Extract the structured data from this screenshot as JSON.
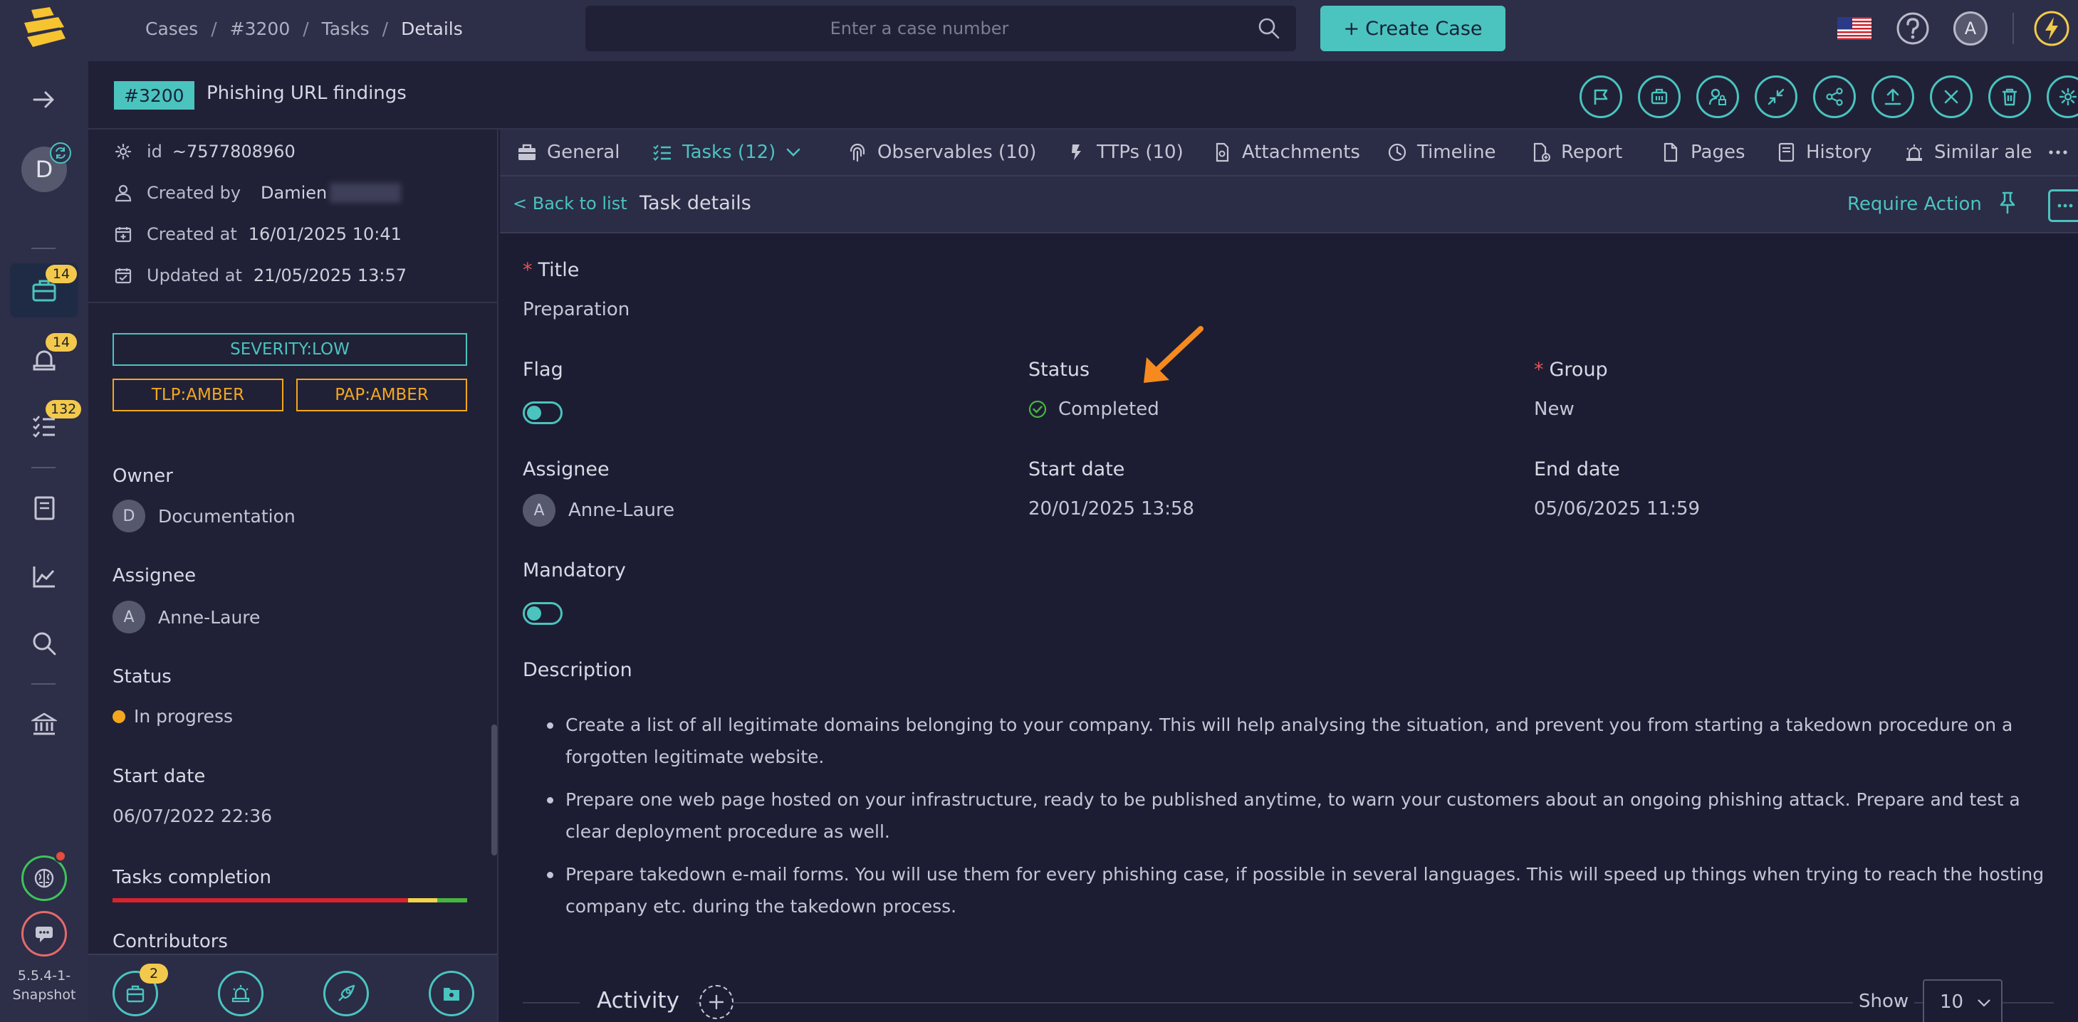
{
  "topbar": {
    "breadcrumb": [
      "Cases",
      "#3200",
      "Tasks",
      "Details"
    ],
    "breadcrumb_sep": "/",
    "search_placeholder": "Enter a case number",
    "create_case_label": "Create Case",
    "create_case_plus": "+",
    "user_initial": "A",
    "accent_color": "#4bc3be"
  },
  "nav": {
    "user_initial": "D",
    "cases_badge": "14",
    "alerts_badge": "14",
    "tasks_badge": "132",
    "version": "5.5.4-1-Snapshot"
  },
  "case": {
    "id_label": "#3200",
    "title": "Phishing URL findings",
    "actions": [
      "flag-icon",
      "merge-icon",
      "share-lock-icon",
      "collapse-icon",
      "share-icon",
      "export-icon",
      "close-icon",
      "delete-icon",
      "settings-icon"
    ]
  },
  "panel": {
    "id_label": "id",
    "id_value": "~7577808960",
    "created_by_label": "Created by",
    "created_by_value": "Damien",
    "created_at_label": "Created at",
    "created_at_value": "16/01/2025 10:41",
    "updated_at_label": "Updated at",
    "updated_at_value": "21/05/2025 13:57",
    "severity": "SEVERITY:LOW",
    "tlp": "TLP:AMBER",
    "pap": "PAP:AMBER",
    "owner_label": "Owner",
    "owner_initial": "D",
    "owner_value": "Documentation",
    "assignee_label": "Assignee",
    "assignee_initial": "A",
    "assignee_value": "Anne-Laure",
    "status_label": "Status",
    "status_value": "In progress",
    "start_date_label": "Start date",
    "start_date_value": "06/07/2022 22:36",
    "tasks_completion_label": "Tasks completion",
    "tasks_completion": {
      "red": 0.834,
      "yellow": 0.082,
      "green": 0.084
    },
    "contributors_label": "Contributors",
    "bottom_badge": "2"
  },
  "tabs": [
    {
      "label": "General",
      "icon": "briefcase-icon"
    },
    {
      "label": "Tasks (12)",
      "icon": "tasks-icon"
    },
    {
      "label": "Observables (10)",
      "icon": "fingerprint-icon"
    },
    {
      "label": "TTPs (10)",
      "icon": "ttp-icon"
    },
    {
      "label": "Attachments",
      "icon": "attachment-icon"
    },
    {
      "label": "Timeline",
      "icon": "clock-icon"
    },
    {
      "label": "Report",
      "icon": "report-icon"
    },
    {
      "label": "Pages",
      "icon": "page-icon"
    },
    {
      "label": "History",
      "icon": "history-icon"
    },
    {
      "label": "Similar ale",
      "icon": "alert-icon"
    }
  ],
  "subheader": {
    "back_label": "< Back to list",
    "title": "Task details",
    "require_action_label": "Require Action"
  },
  "task": {
    "title_label": "Title",
    "title_value": "Preparation",
    "flag_label": "Flag",
    "status_label": "Status",
    "status_value": "Completed",
    "group_label": "Group",
    "group_value": "New",
    "assignee_label": "Assignee",
    "assignee_initial": "A",
    "assignee_value": "Anne-Laure",
    "start_date_label": "Start date",
    "start_date_value": "20/01/2025 13:58",
    "end_date_label": "End date",
    "end_date_value": "05/06/2025 11:59",
    "mandatory_label": "Mandatory",
    "description_label": "Description",
    "required_mark": "*",
    "description_items": [
      "Create a list of all legitimate domains belonging to your company. This will help analysing the situation, and prevent you from starting a takedown procedure on a forgotten legitimate website.",
      "Prepare one web page hosted on your infrastructure, ready to be published anytime, to warn your customers about an ongoing phishing attack. Prepare and test a clear deployment procedure as well.",
      "Prepare takedown e-mail forms. You will use them for every phishing case, if possible in several languages. This will speed up things when trying to reach the hosting company etc. during the takedown process."
    ]
  },
  "activity": {
    "label": "Activity",
    "show_label": "Show",
    "show_value": "10"
  }
}
